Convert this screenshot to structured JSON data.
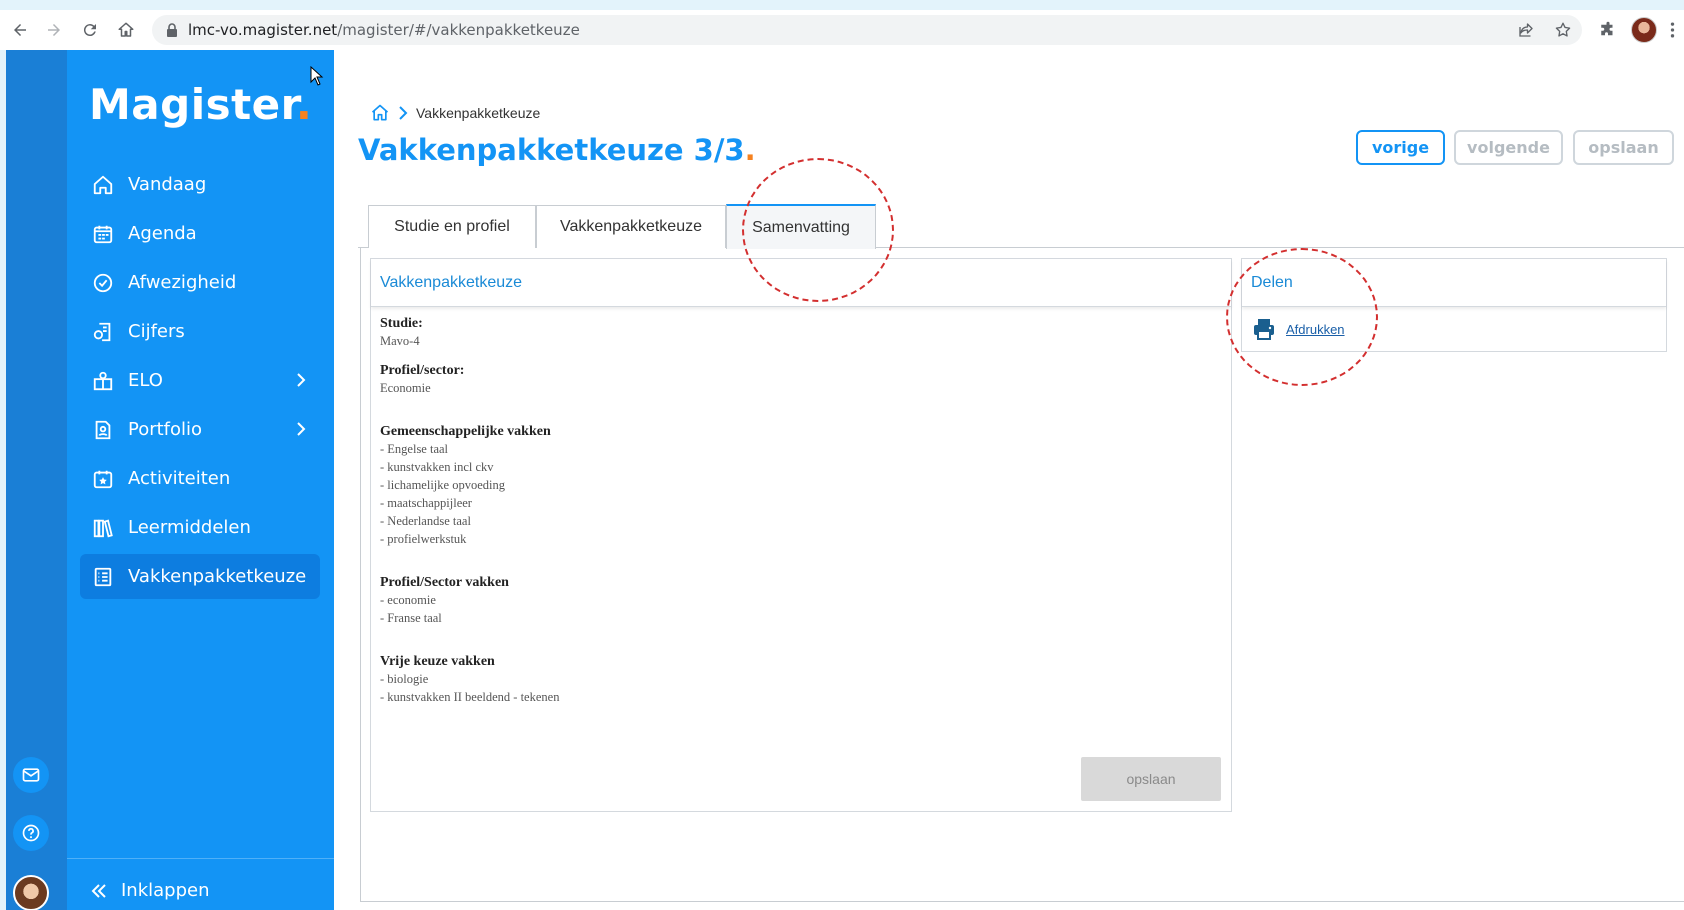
{
  "browser": {
    "url_host": "lmc-vo.magister.net",
    "url_path": "/magister/#/vakkenpakketkeuze"
  },
  "sidebar": {
    "logo": "Magister",
    "items": [
      {
        "label": "Vandaag",
        "icon": "home-icon"
      },
      {
        "label": "Agenda",
        "icon": "calendar-icon"
      },
      {
        "label": "Afwezigheid",
        "icon": "check-circle-icon"
      },
      {
        "label": "Cijfers",
        "icon": "grades-icon"
      },
      {
        "label": "ELO",
        "icon": "elo-icon",
        "has_chevron": true
      },
      {
        "label": "Portfolio",
        "icon": "portfolio-icon",
        "has_chevron": true
      },
      {
        "label": "Activiteiten",
        "icon": "calendar-star-icon"
      },
      {
        "label": "Leermiddelen",
        "icon": "books-icon"
      },
      {
        "label": "Vakkenpakketkeuze",
        "icon": "checklist-icon",
        "active": true
      }
    ],
    "collapse_label": "Inklappen"
  },
  "breadcrumb": {
    "current": "Vakkenpakketkeuze"
  },
  "page": {
    "title": "Vakkenpakketkeuze 3/3"
  },
  "actions": {
    "previous": "vorige",
    "next": "volgende",
    "save": "opslaan"
  },
  "tabs": [
    {
      "label": "Studie en profiel",
      "active": false
    },
    {
      "label": "Vakkenpakketkeuze",
      "active": false
    },
    {
      "label": "Samenvatting",
      "active": true
    }
  ],
  "summary_panel": {
    "header": "Vakkenpakketkeuze",
    "studie_label": "Studie:",
    "studie_value": "Mavo-4",
    "profiel_label": "Profiel/sector:",
    "profiel_value": "Economie",
    "gemeenschappelijk_label": "Gemeenschappelijke vakken",
    "gemeenschappelijk_items": [
      "- Engelse taal",
      "- kunstvakken incl ckv",
      "- lichamelijke opvoeding",
      "- maatschappijleer",
      "- Nederlandse taal",
      "- profielwerkstuk"
    ],
    "sector_label": "Profiel/Sector vakken",
    "sector_items": [
      "- economie",
      "- Franse taal"
    ],
    "vrije_label": "Vrije keuze vakken",
    "vrije_items": [
      "- biologie",
      "- kunstvakken II beeldend - tekenen"
    ],
    "save_button": "opslaan"
  },
  "share_panel": {
    "header": "Delen",
    "print_link": "Afdrukken"
  },
  "colors": {
    "sidebar": "#1394f5",
    "rail": "#1a7fd6",
    "accent_orange": "#f58220",
    "annotation": "#d32f2f"
  }
}
